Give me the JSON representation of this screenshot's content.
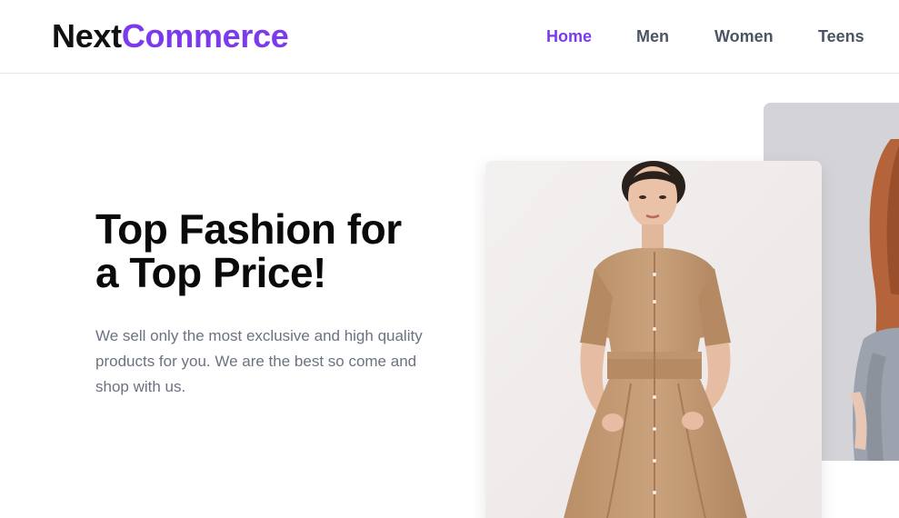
{
  "brand": {
    "part1": "Next",
    "part2": "Commerce",
    "accent_color": "#7c3aed"
  },
  "nav": {
    "items": [
      {
        "label": "Home",
        "active": true
      },
      {
        "label": "Men",
        "active": false
      },
      {
        "label": "Women",
        "active": false
      },
      {
        "label": "Teens",
        "active": false
      }
    ]
  },
  "hero": {
    "title_line1": "Top Fashion for",
    "title_line2": "a Top Price!",
    "description": "We sell only the most exclusive and high quality products for you. We are the best so come and shop with us."
  },
  "images": {
    "front": "model-tan-shirt-dress-photo",
    "back": "model-grey-blazer-photo"
  }
}
